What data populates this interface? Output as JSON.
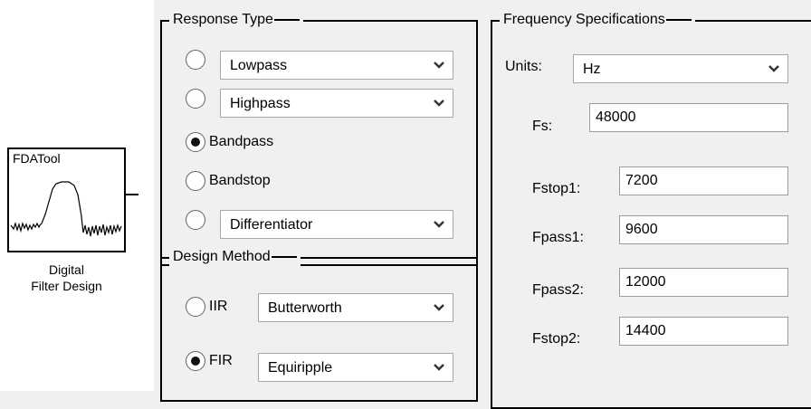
{
  "block": {
    "title": "FDATool",
    "caption_line1": "Digital",
    "caption_line2": "Filter Design"
  },
  "response_type": {
    "title": "Response Type",
    "options": [
      {
        "label": "Lowpass",
        "selected": false,
        "has_dropdown": true
      },
      {
        "label": "Highpass",
        "selected": false,
        "has_dropdown": true
      },
      {
        "label": "Bandpass",
        "selected": true,
        "has_dropdown": false
      },
      {
        "label": "Bandstop",
        "selected": false,
        "has_dropdown": false
      },
      {
        "label": "Differentiator",
        "selected": false,
        "has_dropdown": true
      }
    ]
  },
  "design_method": {
    "title": "Design Method",
    "options": [
      {
        "label": "IIR",
        "dropdown_value": "Butterworth",
        "selected": false
      },
      {
        "label": "FIR",
        "dropdown_value": "Equiripple",
        "selected": true
      }
    ]
  },
  "frequency_specs": {
    "title": "Frequency Specifications",
    "units_label": "Units:",
    "units_value": "Hz",
    "fields": [
      {
        "label": "Fs:",
        "value": "48000"
      },
      {
        "label": "Fstop1:",
        "value": "7200"
      },
      {
        "label": "Fpass1:",
        "value": "9600"
      },
      {
        "label": "Fpass2:",
        "value": "12000"
      },
      {
        "label": "Fstop2:",
        "value": "14400"
      }
    ]
  },
  "icons": [
    "chevron-down-icon",
    "filter-response-icon",
    "radio-icon"
  ]
}
